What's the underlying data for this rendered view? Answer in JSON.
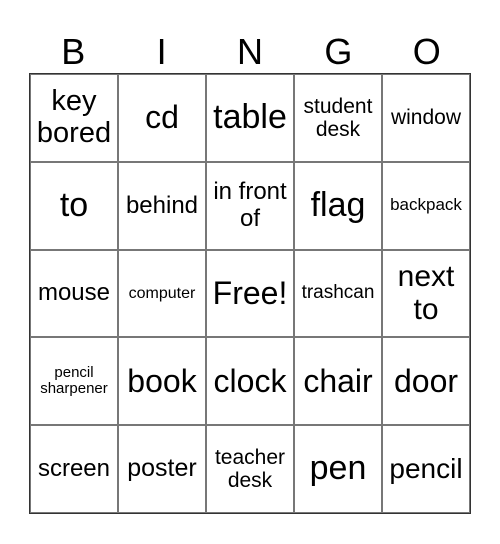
{
  "header": [
    "B",
    "I",
    "N",
    "G",
    "O"
  ],
  "cells": [
    {
      "text": "key\nbored",
      "size": 29
    },
    {
      "text": "cd",
      "size": 32
    },
    {
      "text": "table",
      "size": 34
    },
    {
      "text": "student\ndesk",
      "size": 21
    },
    {
      "text": "window",
      "size": 21
    },
    {
      "text": "to",
      "size": 34
    },
    {
      "text": "behind",
      "size": 24
    },
    {
      "text": "in front\nof",
      "size": 24
    },
    {
      "text": "flag",
      "size": 34
    },
    {
      "text": "backpack",
      "size": 17
    },
    {
      "text": "mouse",
      "size": 24
    },
    {
      "text": "computer",
      "size": 16
    },
    {
      "text": "Free!",
      "size": 32
    },
    {
      "text": "trashcan",
      "size": 19
    },
    {
      "text": "next\nto",
      "size": 30
    },
    {
      "text": "pencil\nsharpener",
      "size": 15
    },
    {
      "text": "book",
      "size": 32
    },
    {
      "text": "clock",
      "size": 32
    },
    {
      "text": "chair",
      "size": 32
    },
    {
      "text": "door",
      "size": 32
    },
    {
      "text": "screen",
      "size": 24
    },
    {
      "text": "poster",
      "size": 25
    },
    {
      "text": "teacher\ndesk",
      "size": 21
    },
    {
      "text": "pen",
      "size": 34
    },
    {
      "text": "pencil",
      "size": 28
    }
  ]
}
